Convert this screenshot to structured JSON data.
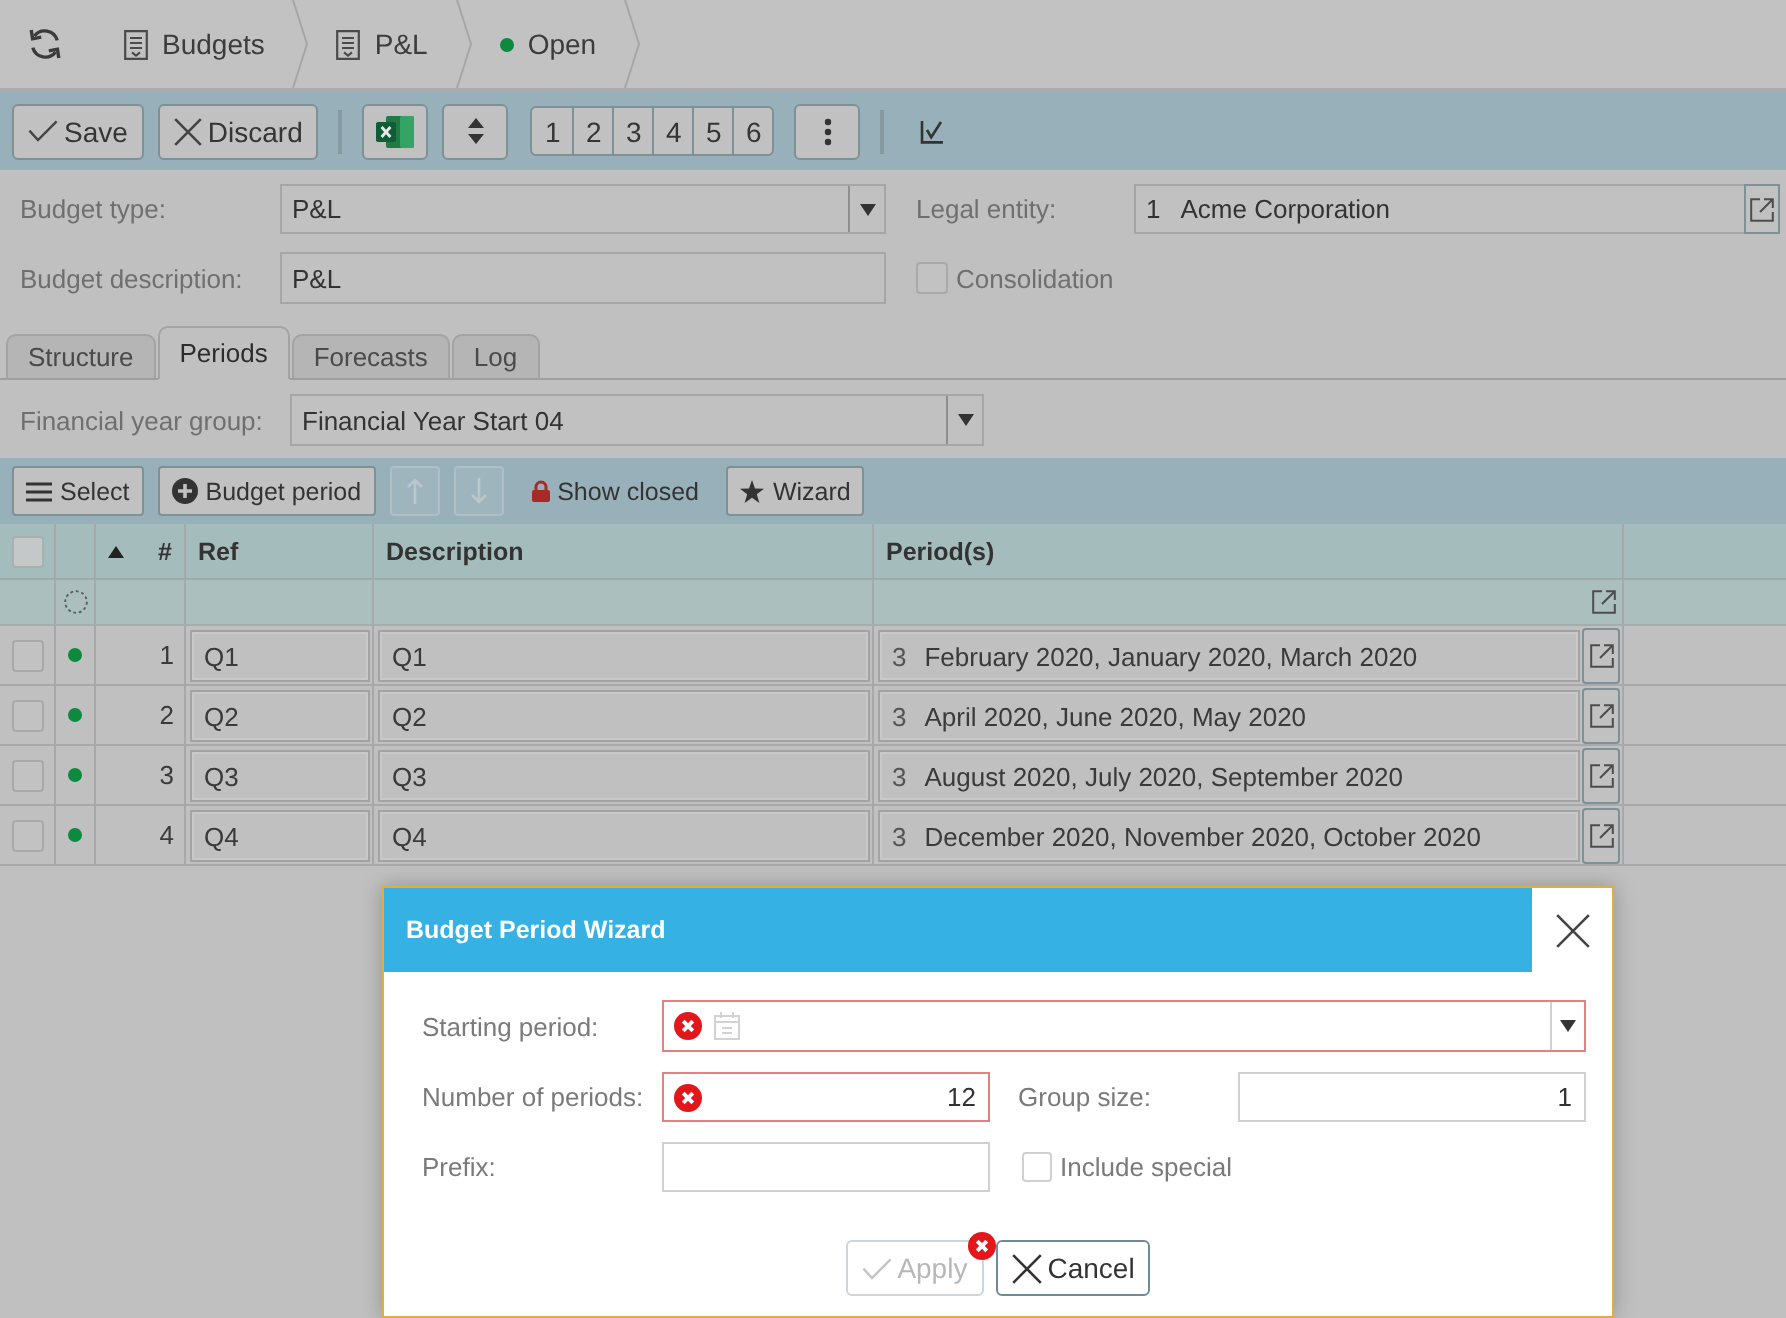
{
  "breadcrumb": [
    {
      "kind": "document",
      "label": "Budgets"
    },
    {
      "kind": "document",
      "label": "P&L"
    },
    {
      "kind": "status",
      "label": "Open",
      "color": "#0e8a3e"
    }
  ],
  "toolbar": {
    "buttons": [
      {
        "kind": "save",
        "label": "Save"
      },
      {
        "kind": "discard",
        "label": "Discard"
      }
    ],
    "level_buttons": [
      "1",
      "2",
      "3",
      "4",
      "5",
      "6"
    ]
  },
  "form": {
    "budget_type": {
      "label": "Budget type:",
      "value": "P&L"
    },
    "legal_entity": {
      "label": "Legal entity:",
      "number": "1",
      "value": "Acme Corporation"
    },
    "budget_description": {
      "label": "Budget description:",
      "value": "P&L"
    },
    "consolidation": {
      "label": "Consolidation",
      "checked": false
    }
  },
  "tabs": [
    {
      "label": "Structure",
      "selected": false
    },
    {
      "label": "Periods",
      "selected": true
    },
    {
      "label": "Forecasts",
      "selected": false
    },
    {
      "label": "Log",
      "selected": false
    }
  ],
  "financial_year_group": {
    "label": "Financial year group:",
    "value": "Financial Year Start 04"
  },
  "grid_toolbar": [
    {
      "kind": "select",
      "label": "Select",
      "disabled": false
    },
    {
      "kind": "add",
      "label": "Budget period",
      "disabled": false
    },
    {
      "kind": "move_up",
      "disabled": true
    },
    {
      "kind": "move_down",
      "disabled": true
    },
    {
      "kind": "toggle",
      "label": "Show closed",
      "disabled": false
    },
    {
      "kind": "wizard",
      "label": "Wizard",
      "disabled": false
    }
  ],
  "table": {
    "select_all": {
      "checked": false
    },
    "columns": [
      {
        "label": "#",
        "sorted_ascending": true
      },
      {
        "label": "Ref",
        "sorted_ascending": false
      },
      {
        "label": "Description",
        "sorted_ascending": false
      },
      {
        "label": "Period(s)",
        "sorted_ascending": false
      }
    ],
    "rows": [
      {
        "checked": false,
        "color": "#0e8a3e",
        "number": "1",
        "ref": "Q1",
        "description": "Q1",
        "period_count": "3",
        "periods": "February 2020, January 2020, March 2020"
      },
      {
        "checked": false,
        "color": "#0e8a3e",
        "number": "2",
        "ref": "Q2",
        "description": "Q2",
        "period_count": "3",
        "periods": "April 2020, June 2020, May 2020"
      },
      {
        "checked": false,
        "color": "#0e8a3e",
        "number": "3",
        "ref": "Q3",
        "description": "Q3",
        "period_count": "3",
        "periods": "August 2020, July 2020, September 2020"
      },
      {
        "checked": false,
        "color": "#0e8a3e",
        "number": "4",
        "ref": "Q4",
        "description": "Q4",
        "period_count": "3",
        "periods": "December 2020, November 2020, October 2020"
      }
    ]
  },
  "dialog": {
    "title": "Budget Period Wizard",
    "starting_period": {
      "label": "Starting period:",
      "error": true
    },
    "number_of_periods": {
      "label": "Number of periods:",
      "value": "12",
      "error": true
    },
    "group_size": {
      "label": "Group size:",
      "value": "1",
      "error": false
    },
    "prefix": {
      "label": "Prefix:",
      "error": false
    },
    "include_special": {
      "label": "Include special",
      "checked": false
    },
    "buttons": [
      {
        "kind": "apply",
        "label": "Apply",
        "disabled": true,
        "error": true
      },
      {
        "kind": "cancel",
        "label": "Cancel",
        "disabled": false,
        "error": false
      }
    ]
  }
}
